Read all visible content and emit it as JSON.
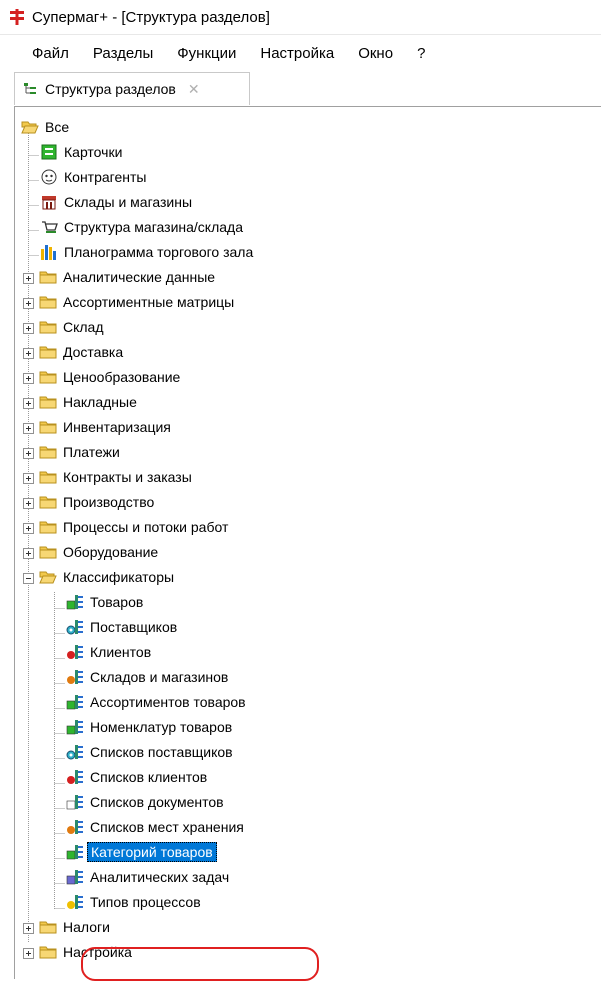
{
  "window": {
    "title": "Супермаг+  - [Структура разделов]"
  },
  "menu": [
    "Файл",
    "Разделы",
    "Функции",
    "Настройка",
    "Окно",
    "?"
  ],
  "tab": {
    "label": "Структура разделов",
    "close": "✕"
  },
  "tree": {
    "root": "Все",
    "root_children": [
      "Карточки",
      "Контрагенты",
      "Склады и магазины",
      "Структура магазина/склада",
      "Планограмма торгового зала"
    ],
    "folders": [
      "Аналитические данные",
      "Ассортиментные матрицы",
      "Склад",
      "Доставка",
      "Ценообразование",
      "Накладные",
      "Инвентаризация",
      "Платежи",
      "Контракты и заказы",
      "Производство",
      "Процессы и потоки работ",
      "Оборудование"
    ],
    "classifiers": {
      "label": "Классификаторы",
      "children": [
        "Товаров",
        "Поставщиков",
        "Клиентов",
        "Складов и магазинов",
        "Ассортиментов товаров",
        "Номенклатур товаров",
        "Списков поставщиков",
        "Списков клиентов",
        "Списков документов",
        "Списков мест хранения",
        "Категорий товаров",
        "Аналитических задач",
        "Типов процессов"
      ],
      "selected": "Категорий товаров"
    },
    "tail_folders": [
      "Налоги",
      "Настройка"
    ]
  },
  "colors": {
    "selection": "#0078d7",
    "folder": "#f2c94c",
    "annotation": "#e02020"
  }
}
